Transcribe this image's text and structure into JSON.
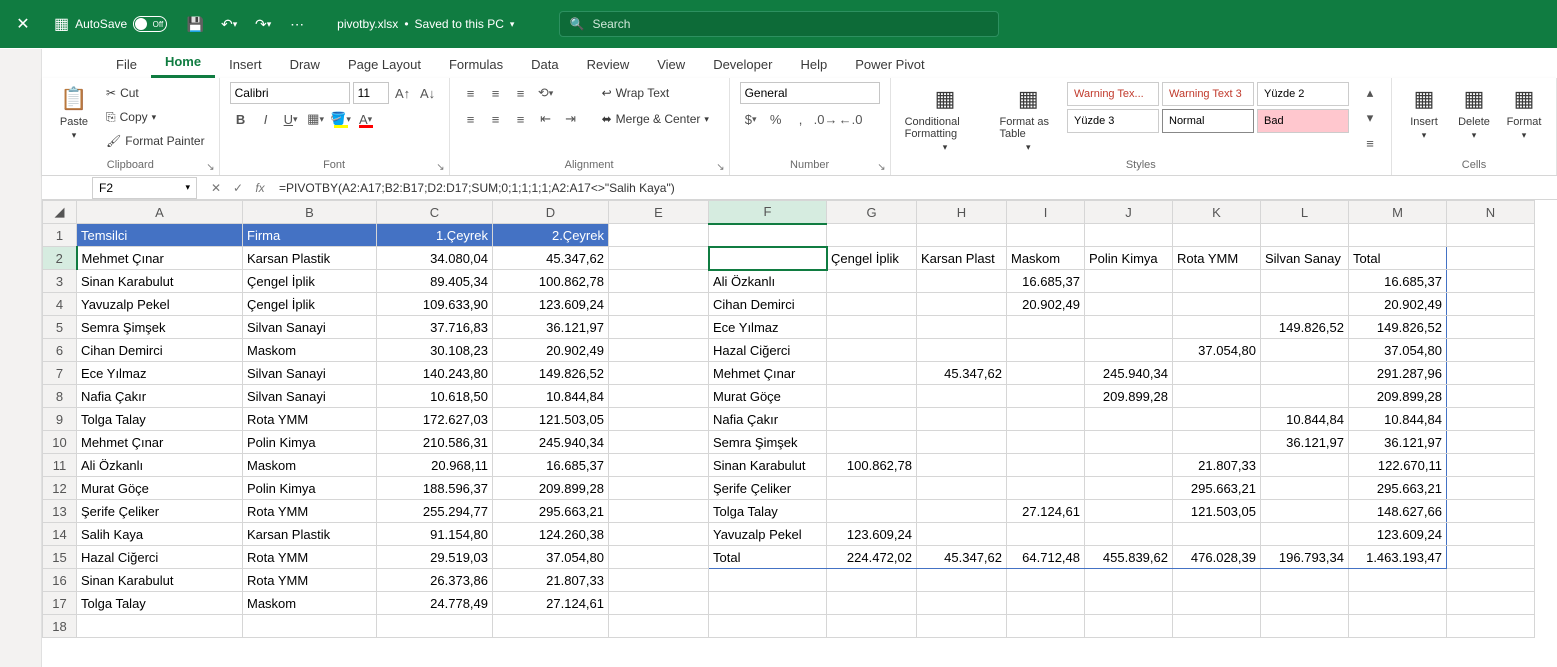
{
  "titlebar": {
    "autosave_label": "AutoSave",
    "autosave_state": "Off",
    "filename": "pivotby.xlsx",
    "savestate": "Saved to this PC",
    "separator": "•",
    "search_placeholder": "Search"
  },
  "tabs": {
    "file": "File",
    "home": "Home",
    "insert": "Insert",
    "draw": "Draw",
    "pagelayout": "Page Layout",
    "formulas": "Formulas",
    "data": "Data",
    "review": "Review",
    "view": "View",
    "developer": "Developer",
    "help": "Help",
    "powerpivot": "Power Pivot"
  },
  "ribbon": {
    "clipboard": {
      "paste": "Paste",
      "cut": "Cut",
      "copy": "Copy",
      "formatpainter": "Format Painter",
      "label": "Clipboard"
    },
    "font": {
      "name": "Calibri",
      "size": "11",
      "label": "Font"
    },
    "alignment": {
      "wrap": "Wrap Text",
      "merge": "Merge & Center",
      "label": "Alignment"
    },
    "number": {
      "format": "General",
      "label": "Number"
    },
    "styles": {
      "cond": "Conditional Formatting",
      "table": "Format as Table",
      "s1": "Warning Tex...",
      "s2": "Warning Text 3",
      "s3": "Yüzde 2",
      "s4": "Yüzde 3",
      "s5": "Normal",
      "s6": "Bad",
      "label": "Styles"
    },
    "cells": {
      "insert": "Insert",
      "delete": "Delete",
      "format": "Format",
      "label": "Cells"
    }
  },
  "formulabar": {
    "namebox": "F2",
    "formula": "=PIVOTBY(A2:A17;B2:B17;D2:D17;SUM;0;1;1;1;1;A2:A17<>\"Salih Kaya\")"
  },
  "columns": [
    "",
    "A",
    "B",
    "C",
    "D",
    "E",
    "F",
    "G",
    "H",
    "I",
    "J",
    "K",
    "L",
    "M",
    "N"
  ],
  "hdr": {
    "a": "Temsilci",
    "b": "Firma",
    "c": "1.Çeyrek",
    "d": "2.Çeyrek"
  },
  "rows": [
    {
      "n": "1"
    },
    {
      "n": "2",
      "a": "Mehmet Çınar",
      "b": "Karsan Plastik",
      "c": "34.080,04",
      "d": "45.347,62"
    },
    {
      "n": "3",
      "a": "Sinan Karabulut",
      "b": "Çengel İplik",
      "c": "89.405,34",
      "d": "100.862,78"
    },
    {
      "n": "4",
      "a": "Yavuzalp Pekel",
      "b": "Çengel İplik",
      "c": "109.633,90",
      "d": "123.609,24"
    },
    {
      "n": "5",
      "a": "Semra Şimşek",
      "b": "Silvan Sanayi",
      "c": "37.716,83",
      "d": "36.121,97"
    },
    {
      "n": "6",
      "a": "Cihan Demirci",
      "b": "Maskom",
      "c": "30.108,23",
      "d": "20.902,49"
    },
    {
      "n": "7",
      "a": "Ece Yılmaz",
      "b": "Silvan Sanayi",
      "c": "140.243,80",
      "d": "149.826,52"
    },
    {
      "n": "8",
      "a": "Nafia Çakır",
      "b": "Silvan Sanayi",
      "c": "10.618,50",
      "d": "10.844,84"
    },
    {
      "n": "9",
      "a": "Tolga Talay",
      "b": "Rota YMM",
      "c": "172.627,03",
      "d": "121.503,05"
    },
    {
      "n": "10",
      "a": "Mehmet Çınar",
      "b": "Polin Kimya",
      "c": "210.586,31",
      "d": "245.940,34"
    },
    {
      "n": "11",
      "a": "Ali Özkanlı",
      "b": "Maskom",
      "c": "20.968,11",
      "d": "16.685,37"
    },
    {
      "n": "12",
      "a": "Murat Göçe",
      "b": "Polin Kimya",
      "c": "188.596,37",
      "d": "209.899,28"
    },
    {
      "n": "13",
      "a": "Şerife Çeliker",
      "b": "Rota YMM",
      "c": "255.294,77",
      "d": "295.663,21"
    },
    {
      "n": "14",
      "a": "Salih Kaya",
      "b": "Karsan Plastik",
      "c": "91.154,80",
      "d": "124.260,38"
    },
    {
      "n": "15",
      "a": "Hazal Ciğerci",
      "b": "Rota YMM",
      "c": "29.519,03",
      "d": "37.054,80"
    },
    {
      "n": "16",
      "a": "Sinan Karabulut",
      "b": "Rota YMM",
      "c": "26.373,86",
      "d": "21.807,33"
    },
    {
      "n": "17",
      "a": "Tolga Talay",
      "b": "Maskom",
      "c": "24.778,49",
      "d": "27.124,61"
    },
    {
      "n": "18"
    }
  ],
  "pivot": {
    "col_headers": {
      "g": "Çengel İplik",
      "h": "Karsan Plast",
      "i": "Maskom",
      "j": "Polin Kimya",
      "k": "Rota YMM",
      "l": "Silvan Sanay",
      "m": "Total"
    },
    "body": [
      {
        "f": "Ali Özkanlı",
        "i": "16.685,37",
        "m": "16.685,37"
      },
      {
        "f": "Cihan Demirci",
        "i": "20.902,49",
        "m": "20.902,49"
      },
      {
        "f": "Ece Yılmaz",
        "l": "149.826,52",
        "m": "149.826,52"
      },
      {
        "f": "Hazal Ciğerci",
        "k": "37.054,80",
        "m": "37.054,80"
      },
      {
        "f": "Mehmet Çınar",
        "h": "45.347,62",
        "j": "245.940,34",
        "m": "291.287,96"
      },
      {
        "f": "Murat Göçe",
        "j": "209.899,28",
        "m": "209.899,28"
      },
      {
        "f": "Nafia Çakır",
        "l": "10.844,84",
        "m": "10.844,84"
      },
      {
        "f": "Semra Şimşek",
        "l": "36.121,97",
        "m": "36.121,97"
      },
      {
        "f": "Sinan Karabulut",
        "g": "100.862,78",
        "k": "21.807,33",
        "m": "122.670,11"
      },
      {
        "f": "Şerife Çeliker",
        "k": "295.663,21",
        "m": "295.663,21"
      },
      {
        "f": "Tolga Talay",
        "i": "27.124,61",
        "k": "121.503,05",
        "m": "148.627,66"
      },
      {
        "f": "Yavuzalp Pekel",
        "g": "123.609,24",
        "m": "123.609,24"
      },
      {
        "f": "Total",
        "g": "224.472,02",
        "h": "45.347,62",
        "i": "64.712,48",
        "j": "455.839,62",
        "k": "476.028,39",
        "l": "196.793,34",
        "m": "1.463.193,47"
      }
    ]
  }
}
